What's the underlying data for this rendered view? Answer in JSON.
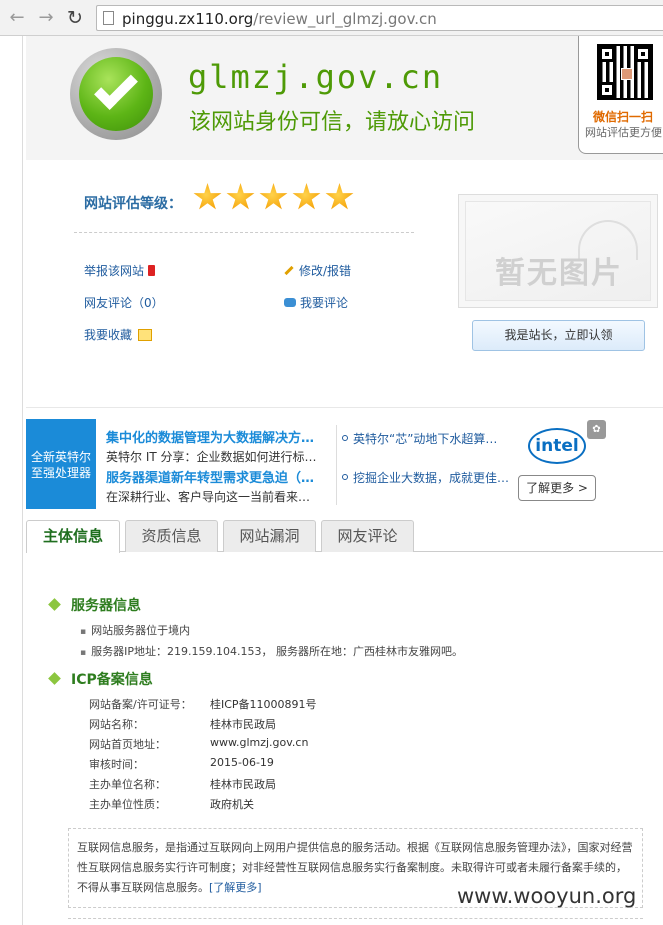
{
  "browser": {
    "url_host": "pinggu.zx110.org",
    "url_path": "/review_url_glmzj.gov.cn"
  },
  "hero": {
    "domain": "glmzj.gov.cn",
    "trust_text": "该网站身份可信，请放心访问",
    "wechat_label": "微信扫一扫",
    "wechat_sub": "网站评估更方便"
  },
  "rating": {
    "label": "网站评估等级：",
    "stars": 5
  },
  "actions": {
    "report": "举报该网站",
    "edit": "修改/报错",
    "comments": "网友评论（0）",
    "write_comment": "我要评论",
    "favorite": "我要收藏"
  },
  "no_image_text": "暂无图片",
  "claim_button": "我是站长，立即认领",
  "ad": {
    "left_line1": "全新英特尔",
    "left_line2": "至强处理器",
    "title1": "集中化的数据管理为大数据解决方…",
    "desc1": "英特尔 IT 分享：企业数据如何进行标…",
    "title2": "服务器渠道新年转型需求更急迫（…",
    "desc2": "在深耕行业、客户导向这一当前看来…",
    "link1": "英特尔“芯”动地下水超算…",
    "link2": "挖掘企业大数据，成就更佳…",
    "brand": "intel",
    "learn_more": "了解更多 >"
  },
  "tabs": [
    {
      "label": "主体信息",
      "active": true
    },
    {
      "label": "资质信息",
      "active": false
    },
    {
      "label": "网站漏洞",
      "active": false
    },
    {
      "label": "网友评论",
      "active": false
    }
  ],
  "server": {
    "heading": "服务器信息",
    "line1": "网站服务器位于境内",
    "line2": "服务器IP地址：219.159.104.153， 服务器所在地：广西桂林市友雅网吧。"
  },
  "icp": {
    "heading": "ICP备案信息",
    "rows": [
      {
        "key": "网站备案/许可证号：",
        "value": "桂ICP备11000891号"
      },
      {
        "key": "网站名称：",
        "value": "桂林市民政局"
      },
      {
        "key": "网站首页地址：",
        "value": "www.glmzj.gov.cn"
      },
      {
        "key": "审核时间：",
        "value": "2015-06-19"
      },
      {
        "key": "主办单位名称：",
        "value": "桂林市民政局"
      },
      {
        "key": "主办单位性质：",
        "value": "政府机关"
      }
    ]
  },
  "notice": {
    "text": "互联网信息服务，是指通过互联网向上网用户提供信息的服务活动。根据《互联网信息服务管理办法》，国家对经营性互联网信息服务实行许可制度；对非经营性互联网信息服务实行备案制度。未取得许可或者未履行备案手续的，不得从事互联网信息服务。",
    "link": "[了解更多]"
  },
  "watermark": "www.wooyun.org"
}
